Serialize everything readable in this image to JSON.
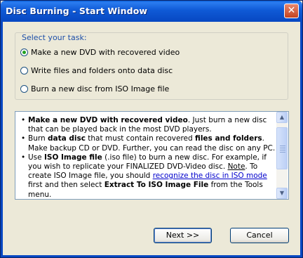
{
  "window": {
    "title": "Disc Burning - Start Window",
    "close_glyph": "✕"
  },
  "task_group": {
    "label": "Select your task:",
    "options": [
      {
        "label": "Make a new DVD with recovered video",
        "checked": true
      },
      {
        "label": "Write files and folders onto data disc",
        "checked": false
      },
      {
        "label": "Burn a new disc from ISO Image file",
        "checked": false
      }
    ]
  },
  "info": {
    "b1_bold": "Make a new DVD with recovered video",
    "b1_rest": ". Just burn a new disc that can be played back in the most DVD players.",
    "b2_pre": "Burn ",
    "b2_bold1": "data disc",
    "b2_mid": " that must contain recovered ",
    "b2_bold2": "files and folders",
    "b2_rest": ". Make backup CD or DVD. Further, you can read the disc on any PC.",
    "b3_pre": "Use ",
    "b3_bold1": "ISO Image file",
    "b3_mid": " (.iso file) to burn a new disc. For example, if you wish to replicate your FINALIZED DVD-Video disc. ",
    "b3_note": "Note",
    "b3_mid2": ". To create ISO Image file, you should ",
    "b3_link": "recognize the disc in ISO mode",
    "b3_mid3": " first and then select ",
    "b3_bold2": "Extract To ISO Image File",
    "b3_rest": " from the Tools menu."
  },
  "buttons": {
    "next": "Next >>",
    "cancel": "Cancel"
  },
  "icons": {
    "scroll_up": "▲",
    "scroll_down": "▼"
  }
}
